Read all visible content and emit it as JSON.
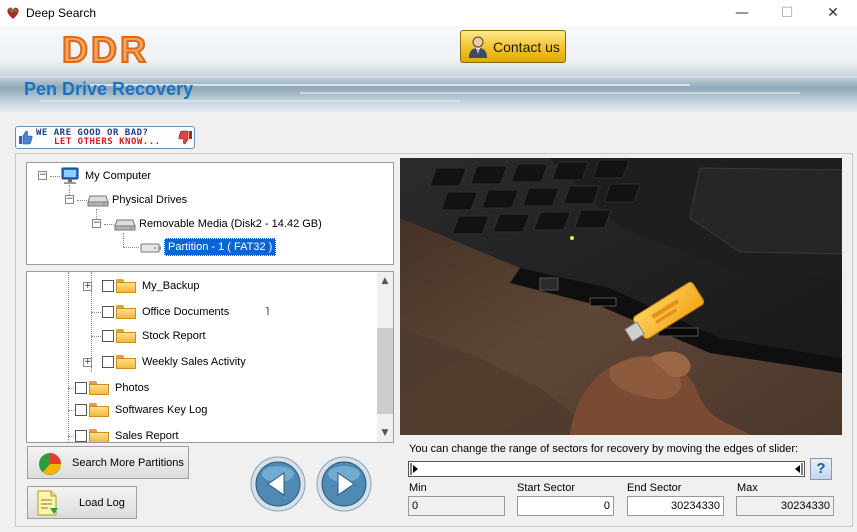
{
  "window": {
    "title": "Deep Search",
    "minimize": "—",
    "maximize": "☐",
    "close": "✕"
  },
  "banner": {
    "logo": "DDR",
    "product_name": "Pen Drive Recovery",
    "contact_label": "Contact us"
  },
  "feedback": {
    "line1": "WE ARE GOOD OR BAD?",
    "line2": "LET OTHERS KNOW..."
  },
  "drive_tree": {
    "root": "My Computer",
    "physical": "Physical Drives",
    "removable": "Removable Media (Disk2 - 14.42 GB)",
    "partition": "Partition - 1 ( FAT32 )"
  },
  "folder_tree": {
    "items": [
      {
        "label": "My_Backup",
        "expandable": true
      },
      {
        "label": "Office Documents",
        "expandable": false
      },
      {
        "label": "Stock Report",
        "expandable": false
      },
      {
        "label": "Weekly Sales Activity",
        "expandable": true
      },
      {
        "label": "Photos",
        "expandable": false
      },
      {
        "label": "Softwares Key Log",
        "expandable": false
      },
      {
        "label": "Sales Report",
        "expandable": false
      }
    ],
    "scroll_up": "▲",
    "scroll_down": "▼",
    "stray_mark": "˥"
  },
  "buttons": {
    "search_more": "Search More Partitions",
    "load_log": "Load Log"
  },
  "slider": {
    "hint": "You can change the range of sectors for recovery by moving the edges of slider:",
    "help": "?"
  },
  "sectors": {
    "min_label": "Min",
    "min_value": "0",
    "start_label": "Start Sector",
    "start_value": "0",
    "end_label": "End Sector",
    "end_value": "30234330",
    "max_label": "Max",
    "max_value": "30234330"
  },
  "colors": {
    "selection": "#0a64d6",
    "logo_orange": "#f7a35a",
    "product_blue": "#1a72c2",
    "contact_gold": "#f4c22b"
  }
}
